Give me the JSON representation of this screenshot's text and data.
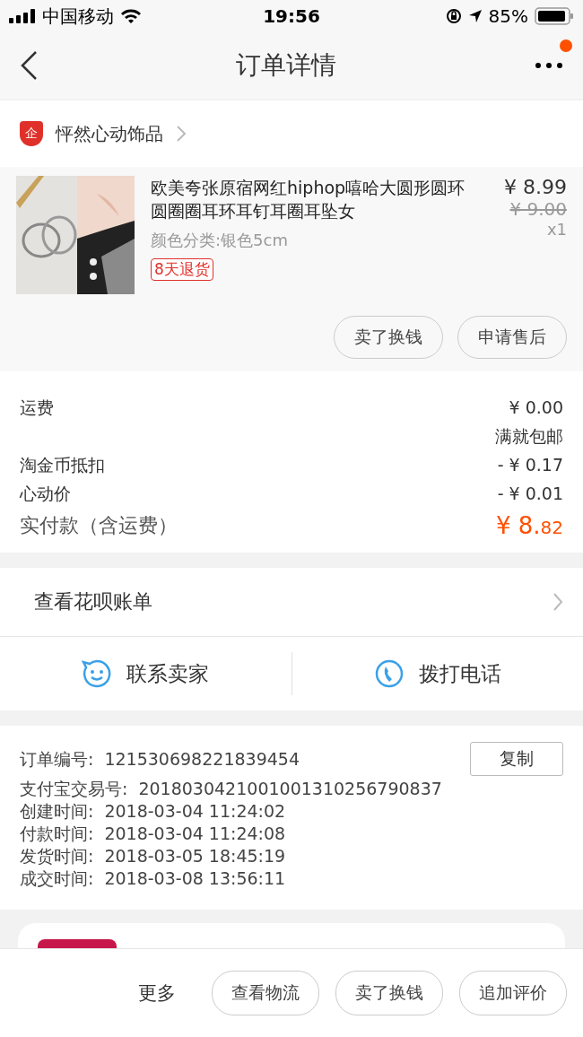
{
  "status_bar": {
    "carrier": "中国移动",
    "time": "19:56",
    "battery": "85%"
  },
  "nav": {
    "title": "订单详情",
    "has_notification": true
  },
  "shop": {
    "name": "怦然心动饰品",
    "badge": "企"
  },
  "product": {
    "title": "欧美夸张原宿网红hiphop嘻哈大圆形圆环圆圈圈耳环耳钉耳圈耳坠女",
    "variant": "颜色分类:银色5cm",
    "tag": "8天退货",
    "price": "¥ 8.99",
    "original_price": "¥ 9.00",
    "quantity": "x1",
    "buttons": [
      "卖了换钱",
      "申请售后"
    ]
  },
  "charges": [
    {
      "label": "运费",
      "value": "¥ 0.00",
      "note": "满就包邮"
    },
    {
      "label": "淘金币抵扣",
      "value": "- ¥ 0.17"
    },
    {
      "label": "心动价",
      "value": "- ¥ 0.01"
    }
  ],
  "total": {
    "label": "实付款（含运费）",
    "main": "¥ 8.",
    "fraction": "82"
  },
  "huabei": {
    "label": "查看花呗账单"
  },
  "contact": [
    {
      "kind": "chat",
      "label": "联系卖家"
    },
    {
      "kind": "phone",
      "label": "拨打电话"
    }
  ],
  "order_info": {
    "copy_button": "复制",
    "rows": [
      {
        "label": "订单编号:",
        "value": "121530698221839454"
      },
      {
        "label": "支付宝交易号:",
        "value": "2018030421001001310256790837"
      },
      {
        "label": "创建时间:",
        "value": "2018-03-04 11:24:02"
      },
      {
        "label": "付款时间:",
        "value": "2018-03-04 11:24:08"
      },
      {
        "label": "发货时间:",
        "value": "2018-03-05 18:45:19"
      },
      {
        "label": "成交时间:",
        "value": "2018-03-08 13:56:11"
      }
    ]
  },
  "bottom_bar": {
    "more": "更多",
    "buttons": [
      "查看物流",
      "卖了换钱",
      "追加评价"
    ]
  }
}
